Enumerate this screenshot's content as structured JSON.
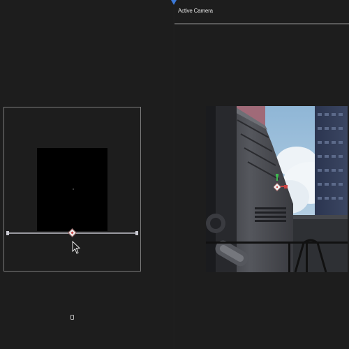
{
  "right_view": {
    "header_title": "Active Camera"
  },
  "colors": {
    "accent": "#3b79d8",
    "background": "#1d1d1d",
    "frame": "#7a7a7a",
    "handle_red": "#cc4444",
    "gizmo_green": "#3fb950"
  },
  "icons": {
    "cursor": "mouse-pointer-icon",
    "handle": "diamond-handle-icon",
    "gizmo": "transform-gizmo-icon",
    "marker": "view-marker-icon"
  }
}
